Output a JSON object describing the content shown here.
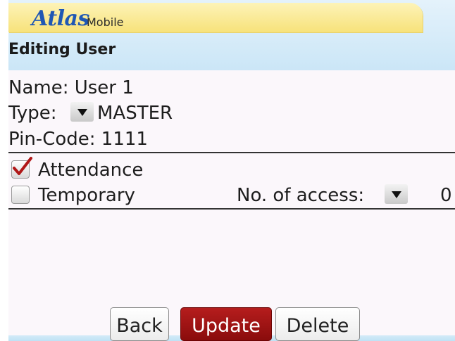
{
  "app": {
    "logo_brand": "Atlas",
    "logo_suffix": "Mobile",
    "screen_title": "Editing User"
  },
  "user": {
    "name_label": "Name:",
    "name_value": "User 1",
    "type_label": "Type:",
    "type_value": "MASTER",
    "pin_label": "Pin-Code:",
    "pin_value": "1111"
  },
  "options": {
    "attendance_label": "Attendance",
    "attendance_checked": true,
    "temporary_label": "Temporary",
    "temporary_checked": false,
    "access_label": "No. of access:",
    "access_value": "0"
  },
  "buttons": {
    "back": "Back",
    "update": "Update",
    "delete": "Delete"
  },
  "colors": {
    "brand_blue": "#1f57b4",
    "primary_button": "#a31414",
    "check_red": "#b01818"
  }
}
